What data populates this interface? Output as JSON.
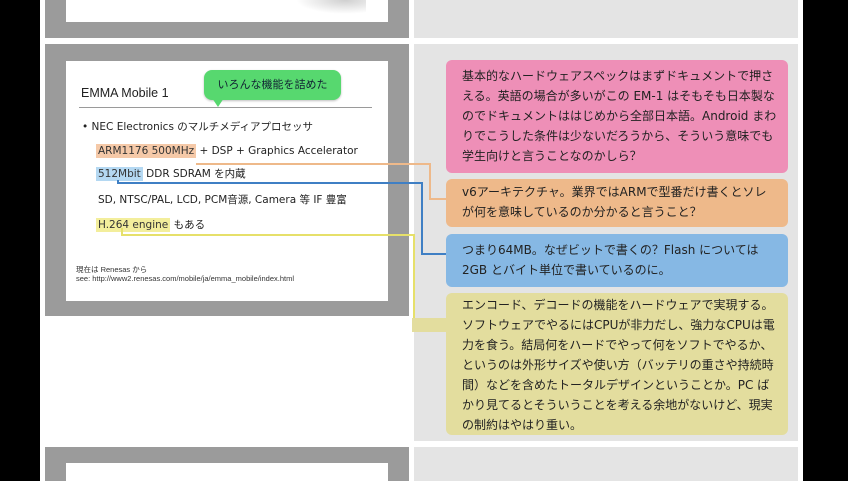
{
  "slide": {
    "title": "EMMA Mobile 1",
    "bubble": "いろんな機能を詰めた",
    "bullet": "• NEC Electronics のマルチメディアプロセッサ",
    "line1_highlight": "ARM1176 500MHz",
    "line1_rest": "+ DSP + Graphics Accelerator",
    "line2_highlight": "512Mbit",
    "line2_rest": "DDR SDRAM を内蔵",
    "line3": "SD, NTSC/PAL, LCD, PCM音源, Camera 等 IF 豊富",
    "line4_highlight": "H.264 engine",
    "line4_rest": "もある",
    "footer1": "現在は Renesas から",
    "footer2": "see: http://www2.renesas.com/mobile/ja/emma_mobile/index.html"
  },
  "notes": [
    {
      "text": "基本的なハードウェアスペックはまずドキュメントで押さえる。英語の場合が多いがこの EM-1 はそもそも日本製なのでドキュメントははじめから全部日本語。Android まわりでこうした条件は少ないだろうから、そういう意味でも学生向けと言うことなのかしら？"
    },
    {
      "text": "v6アーキテクチャ。業界ではARMで型番だけ書くとソレが何を意味しているのか分かると言うこと？"
    },
    {
      "text": "つまり64MB。なぜビットで書くの？Flash については 2GB とバイト単位で書いているのに。"
    },
    {
      "text": "エンコード、デコードの機能をハードウェアで実現する。ソフトウェアでやるにはCPUが非力だし、強力なCPUは電力を食う。結局何をハードでやって何をソフトでやるか、というのは外形サイズや使い方（バッテリの重さや持続時間）などを含めたトータルデザインということか。PC ばかり見てるとそういうことを考える余地がないけど、現実の制約はやはり重い。"
    }
  ],
  "colors": {
    "pink": "#ee8fb7",
    "orange": "#eeb98a",
    "blue": "#86b8e4",
    "yellow": "#e3dd9e",
    "bubble_green": "#57d86f"
  }
}
